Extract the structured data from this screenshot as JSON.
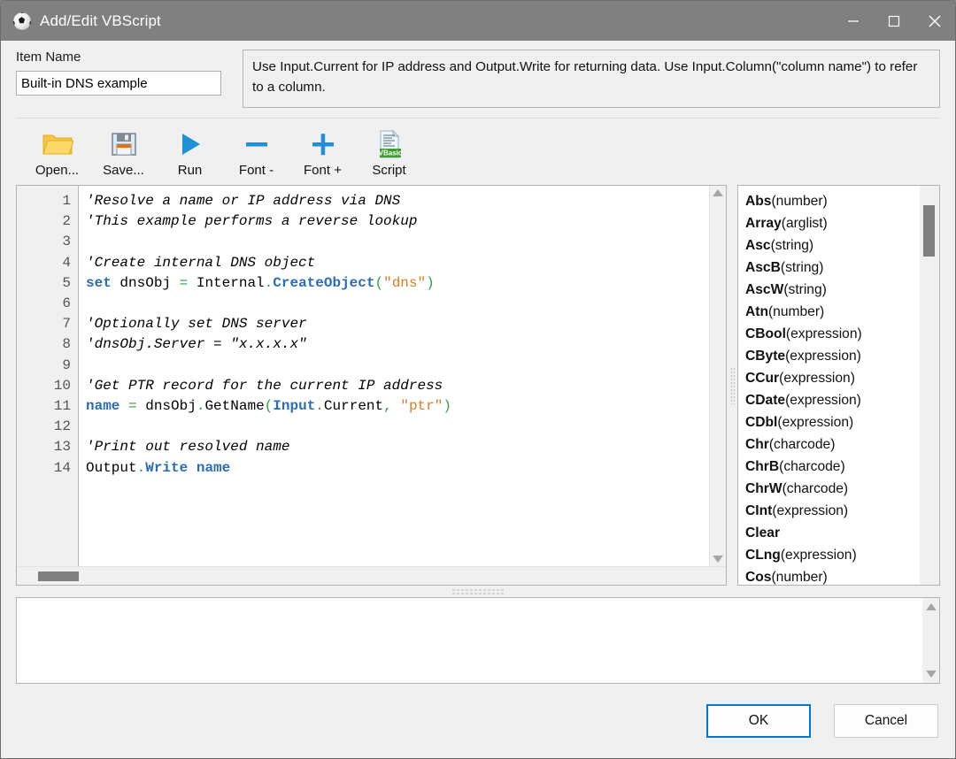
{
  "window": {
    "title": "Add/Edit VBScript",
    "icon": "soccer-ball-icon",
    "minimize_label": "Minimize",
    "maximize_label": "Maximize",
    "close_label": "Close",
    "titlebar_color": "#808080"
  },
  "form": {
    "item_name_label": "Item Name",
    "item_name_value": "Built-in DNS example",
    "item_name_placeholder": "Item Name",
    "help_text": "Use Input.Current for IP address and Output.Write for returning data. Use Input.Column(\"column name\") to refer to a column."
  },
  "toolbar": {
    "buttons": [
      {
        "label": "Open...",
        "icon": "folder-open-icon"
      },
      {
        "label": "Save...",
        "icon": "floppy-save-icon"
      },
      {
        "label": "Run",
        "icon": "play-triangle-icon"
      },
      {
        "label": "Font -",
        "icon": "minus-icon"
      },
      {
        "label": "Font +",
        "icon": "plus-icon"
      },
      {
        "label": "Script",
        "icon": "vbasic-document-icon"
      }
    ]
  },
  "editor": {
    "line_numbers": [
      1,
      2,
      3,
      4,
      5,
      6,
      7,
      8,
      9,
      10,
      11,
      12,
      13,
      14
    ],
    "lines": [
      {
        "n": 1,
        "tokens": [
          {
            "t": "comment",
            "v": "'Resolve a name or IP address via DNS"
          }
        ]
      },
      {
        "n": 2,
        "tokens": [
          {
            "t": "comment",
            "v": "'This example performs a reverse lookup"
          }
        ]
      },
      {
        "n": 3,
        "tokens": []
      },
      {
        "n": 4,
        "tokens": [
          {
            "t": "comment",
            "v": "'Create internal DNS object"
          }
        ]
      },
      {
        "n": 5,
        "tokens": [
          {
            "t": "keyword",
            "v": "set"
          },
          {
            "t": "plain",
            "v": " dnsObj "
          },
          {
            "t": "operator",
            "v": "="
          },
          {
            "t": "plain",
            "v": " Internal"
          },
          {
            "t": "operator",
            "v": "."
          },
          {
            "t": "keyword",
            "v": "CreateObject"
          },
          {
            "t": "operator",
            "v": "("
          },
          {
            "t": "string",
            "v": "\"dns\""
          },
          {
            "t": "operator",
            "v": ")"
          }
        ]
      },
      {
        "n": 6,
        "tokens": []
      },
      {
        "n": 7,
        "tokens": [
          {
            "t": "comment",
            "v": "'Optionally set DNS server"
          }
        ]
      },
      {
        "n": 8,
        "tokens": [
          {
            "t": "comment",
            "v": "'dnsObj.Server = \"x.x.x.x\""
          }
        ]
      },
      {
        "n": 9,
        "tokens": []
      },
      {
        "n": 10,
        "tokens": [
          {
            "t": "comment",
            "v": "'Get PTR record for the current IP address"
          }
        ]
      },
      {
        "n": 11,
        "tokens": [
          {
            "t": "keyword",
            "v": "name"
          },
          {
            "t": "plain",
            "v": " "
          },
          {
            "t": "operator",
            "v": "="
          },
          {
            "t": "plain",
            "v": " dnsObj"
          },
          {
            "t": "operator",
            "v": "."
          },
          {
            "t": "plain",
            "v": "GetName"
          },
          {
            "t": "operator",
            "v": "("
          },
          {
            "t": "keyword",
            "v": "Input"
          },
          {
            "t": "operator",
            "v": "."
          },
          {
            "t": "plain",
            "v": "Current"
          },
          {
            "t": "operator",
            "v": ","
          },
          {
            "t": "plain",
            "v": " "
          },
          {
            "t": "string",
            "v": "\"ptr\""
          },
          {
            "t": "operator",
            "v": ")"
          }
        ]
      },
      {
        "n": 12,
        "tokens": []
      },
      {
        "n": 13,
        "tokens": [
          {
            "t": "comment",
            "v": "'Print out resolved name"
          }
        ]
      },
      {
        "n": 14,
        "tokens": [
          {
            "t": "plain",
            "v": "Output"
          },
          {
            "t": "operator",
            "v": "."
          },
          {
            "t": "keyword",
            "v": "Write"
          },
          {
            "t": "plain",
            "v": " "
          },
          {
            "t": "keyword",
            "v": "name"
          }
        ]
      }
    ],
    "colors": {
      "comment": "#000000",
      "keyword": "#2b6cb8",
      "operator": "#2f9e44",
      "string": "#e07b20",
      "plain": "#000000",
      "gutter_bg": "#f0f0f0"
    },
    "scroll_up_icon": "scroll-up-arrow-icon",
    "scroll_down_icon": "scroll-down-arrow-icon"
  },
  "function_list": {
    "items": [
      {
        "name": "Abs",
        "args": "(number)"
      },
      {
        "name": "Array",
        "args": "(arglist)"
      },
      {
        "name": "Asc",
        "args": "(string)"
      },
      {
        "name": "AscB",
        "args": "(string)"
      },
      {
        "name": "AscW",
        "args": "(string)"
      },
      {
        "name": "Atn",
        "args": "(number)"
      },
      {
        "name": "CBool",
        "args": "(expression)"
      },
      {
        "name": "CByte",
        "args": "(expression)"
      },
      {
        "name": "CCur",
        "args": "(expression)"
      },
      {
        "name": "CDate",
        "args": "(expression)"
      },
      {
        "name": "CDbl",
        "args": "(expression)"
      },
      {
        "name": "Chr",
        "args": "(charcode)"
      },
      {
        "name": "ChrB",
        "args": "(charcode)"
      },
      {
        "name": "ChrW",
        "args": "(charcode)"
      },
      {
        "name": "CInt",
        "args": "(expression)"
      },
      {
        "name": "Clear",
        "args": ""
      },
      {
        "name": "CLng",
        "args": "(expression)"
      },
      {
        "name": "Cos",
        "args": "(number)"
      }
    ]
  },
  "output": {
    "text": ""
  },
  "footer": {
    "ok_label": "OK",
    "cancel_label": "Cancel",
    "focus_color": "#0078d4"
  }
}
